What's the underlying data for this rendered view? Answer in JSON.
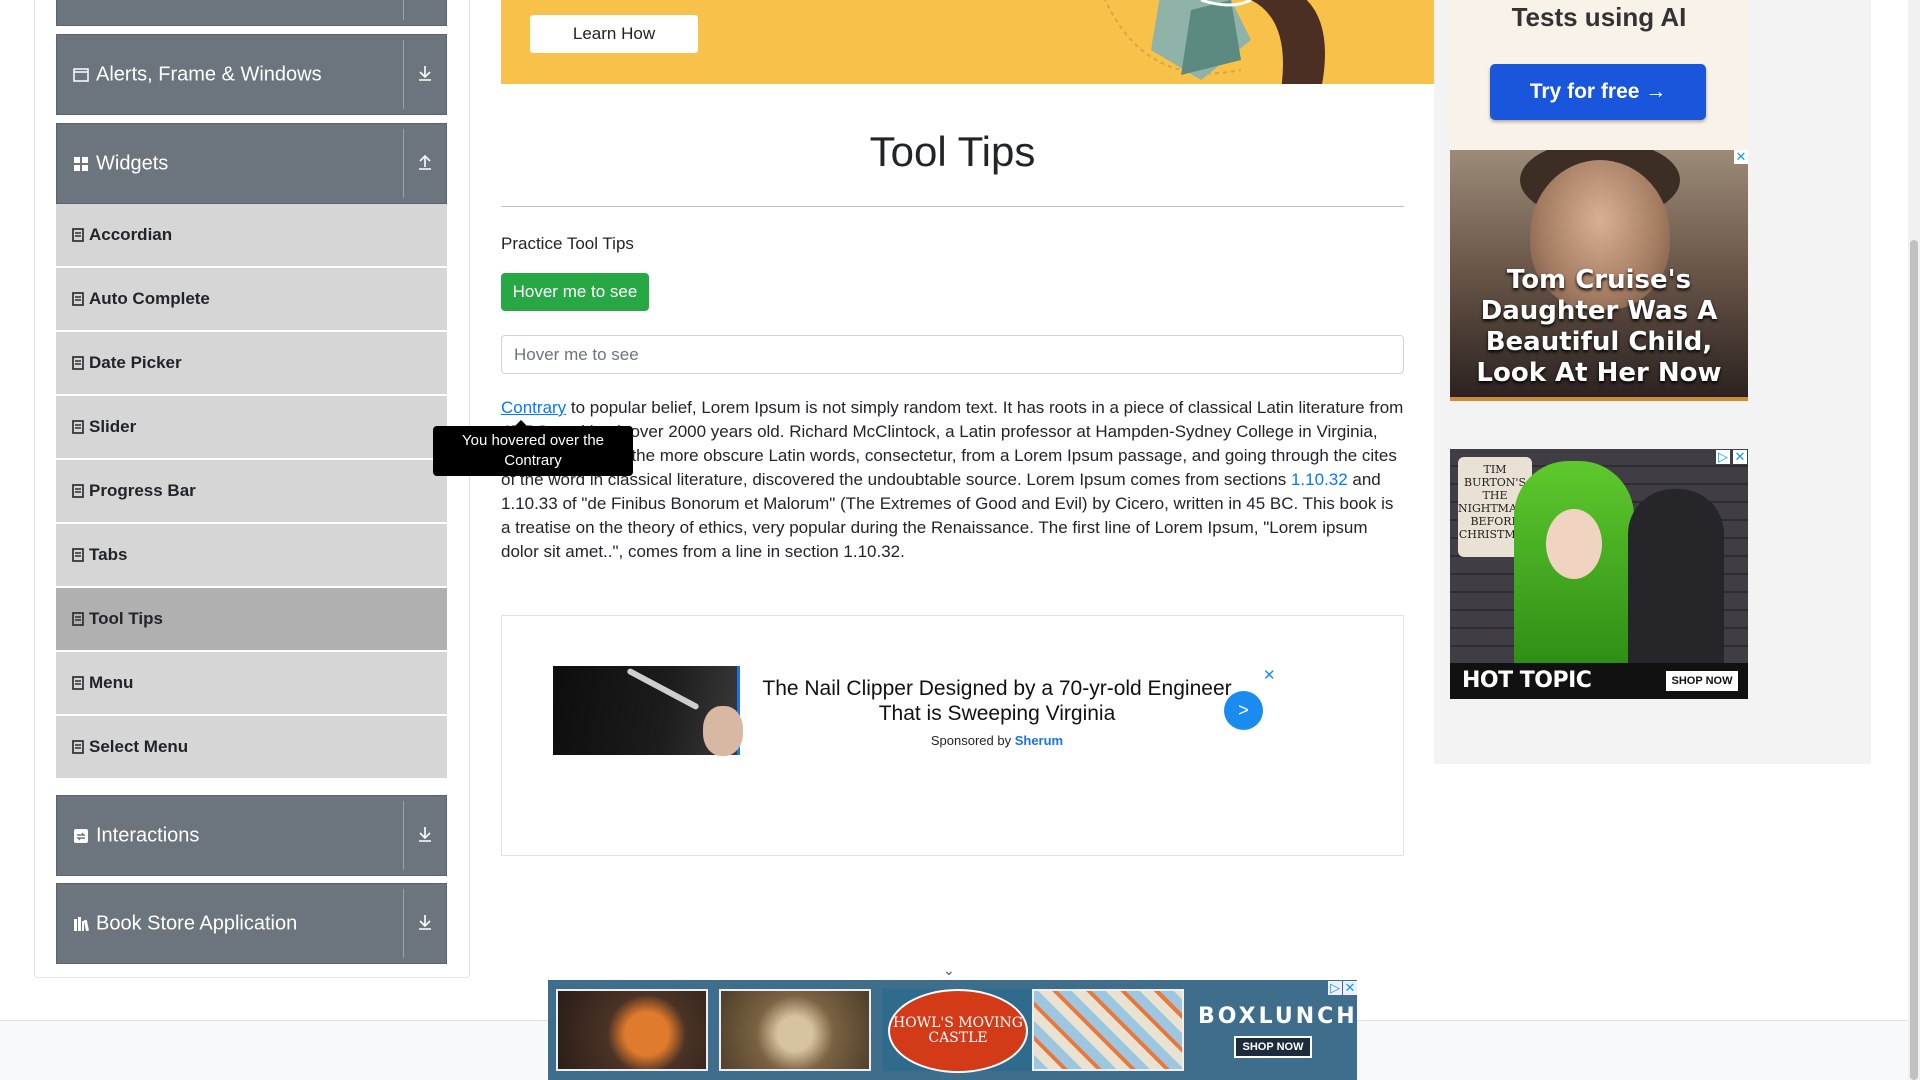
{
  "sidebar": {
    "groups": [
      {
        "title": "Alerts, Frame & Windows",
        "icon": "window-icon",
        "toggle": "download-icon"
      },
      {
        "title": "Widgets",
        "icon": "grid-icon",
        "toggle": "upload-icon"
      },
      {
        "title": "Interactions",
        "icon": "interactions-icon",
        "toggle": "download-icon"
      },
      {
        "title": "Book Store Application",
        "icon": "bookstore-icon",
        "toggle": "download-icon"
      }
    ],
    "items": [
      {
        "label": "Accordian"
      },
      {
        "label": "Auto Complete"
      },
      {
        "label": "Date Picker"
      },
      {
        "label": "Slider"
      },
      {
        "label": "Progress Bar"
      },
      {
        "label": "Tabs"
      },
      {
        "label": "Tool Tips",
        "active": true
      },
      {
        "label": "Menu"
      },
      {
        "label": "Select Menu"
      }
    ]
  },
  "banner": {
    "button": "Learn How"
  },
  "right_ads": {
    "ai_title": "Tests using AI",
    "ai_button": "Try for free →",
    "cruise_caption": "Tom Cruise's Daughter Was A Beautiful Child, Look At Her Now",
    "hot_sign": "TIM BURTON'S THE NIGHTMARE BEFORE CHRISTMAS",
    "hot_brand": "HOT TOPIC",
    "hot_shop": "SHOP NOW"
  },
  "main": {
    "title": "Tool Tips",
    "practice": "Practice Tool Tips",
    "hover_button": "Hover me to see",
    "hover_input_placeholder": "Hover me to see",
    "para_link": "Contrary",
    "para_text_1": " to popular belief, Lorem Ipsum is not simply random text. It has roots in a piece of classical Latin literature from 45 BC, making it over 2000 years old. Richard McClintock, a Latin professor at Hampden-Sydney College in Virginia, looked up one of the more obscure Latin words, consectetur, from a Lorem Ipsum passage, and going through the cites of the word in classical literature, discovered the undoubtable source. Lorem Ipsum comes from sections ",
    "para_link_2": "1.10.32",
    "para_text_2": " and 1.10.33 of \"de Finibus Bonorum et Malorum\" (The Extremes of Good and Evil) by Cicero, written in 45 BC. This book is a treatise on the theory of ethics, very popular during the Renaissance. The first line of Lorem Ipsum, \"Lorem ipsum dolor sit amet..\", comes from a line in section 1.10.32.",
    "tooltip": "You hovered over the Contrary"
  },
  "mid_ad": {
    "headline": "The Nail Clipper Designed by a 70-yr-old Engineer That is Sweeping Virginia",
    "sponsored_by": "Sponsored by",
    "sponsor": "Sherum",
    "go": ">",
    "close": "✕"
  },
  "bottom_ad": {
    "oval_text": "HOWL'S MOVING CASTLE",
    "brand": "BOXLUNCH",
    "shop": "SHOP NOW",
    "chevron": "⌄"
  },
  "colors": {
    "accent_green": "#28a745",
    "sidebar_group": "#6c757d",
    "link_blue": "#007bff",
    "banner_yellow": "#f8c24a"
  }
}
